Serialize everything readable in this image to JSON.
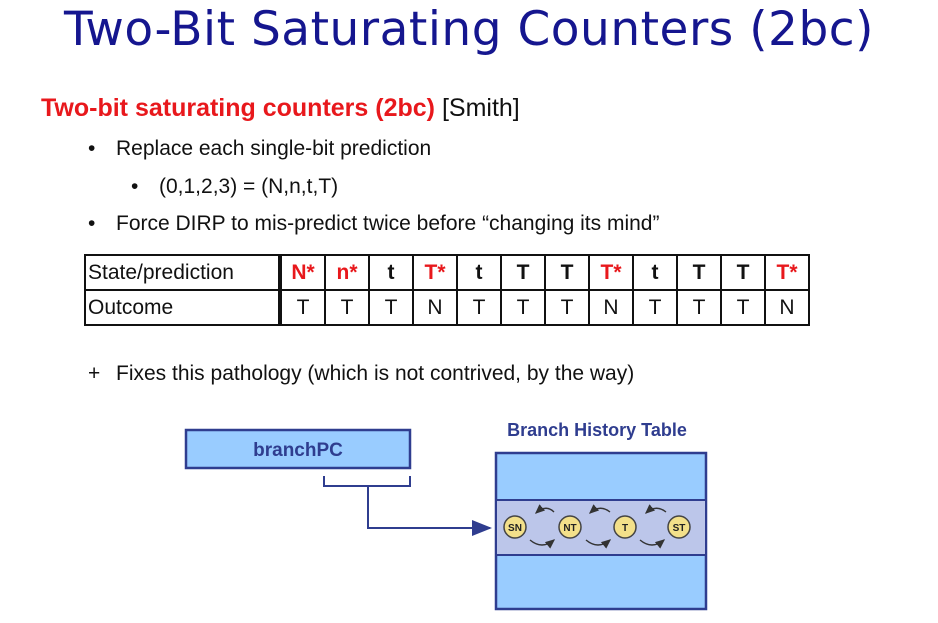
{
  "title": "Two-Bit Saturating Counters (2bc)",
  "subtitle": {
    "highlight": "Two-bit saturating counters (2bc)",
    "citation": "[Smith]"
  },
  "bullets": [
    {
      "mark": "•",
      "text": "Replace each single-bit prediction"
    },
    {
      "mark": "•",
      "text": "(0,1,2,3) = (N,n,t,T)"
    },
    {
      "mark": "•",
      "text": "Force DIRP to mis-predict twice before “changing its mind”"
    },
    {
      "mark": "+",
      "text": "Fixes this pathology (which is not contrived, by the way)"
    }
  ],
  "table": {
    "row_headers": [
      "State/prediction",
      "Outcome"
    ],
    "states": [
      {
        "label": "N*",
        "mispredict": true
      },
      {
        "label": "n*",
        "mispredict": true
      },
      {
        "label": "t",
        "mispredict": false
      },
      {
        "label": "T*",
        "mispredict": true
      },
      {
        "label": "t",
        "mispredict": false
      },
      {
        "label": "T",
        "mispredict": false
      },
      {
        "label": "T",
        "mispredict": false
      },
      {
        "label": "T*",
        "mispredict": true
      },
      {
        "label": "t",
        "mispredict": false
      },
      {
        "label": "T",
        "mispredict": false
      },
      {
        "label": "T",
        "mispredict": false
      },
      {
        "label": "T*",
        "mispredict": true
      }
    ],
    "outcomes": [
      "T",
      "T",
      "T",
      "N",
      "T",
      "T",
      "T",
      "N",
      "T",
      "T",
      "T",
      "N"
    ]
  },
  "diagram": {
    "pc_label": "branchPC",
    "bht_label": "Branch History Table",
    "states": [
      "SN",
      "NT",
      "T",
      "ST"
    ]
  },
  "colors": {
    "title": "#15168f",
    "highlight": "#e8181c",
    "box_fill": "#99ccff",
    "box_stroke": "#2f3d8f",
    "row_fill": "#bcc6ea",
    "state_fill": "#f3e08a"
  }
}
